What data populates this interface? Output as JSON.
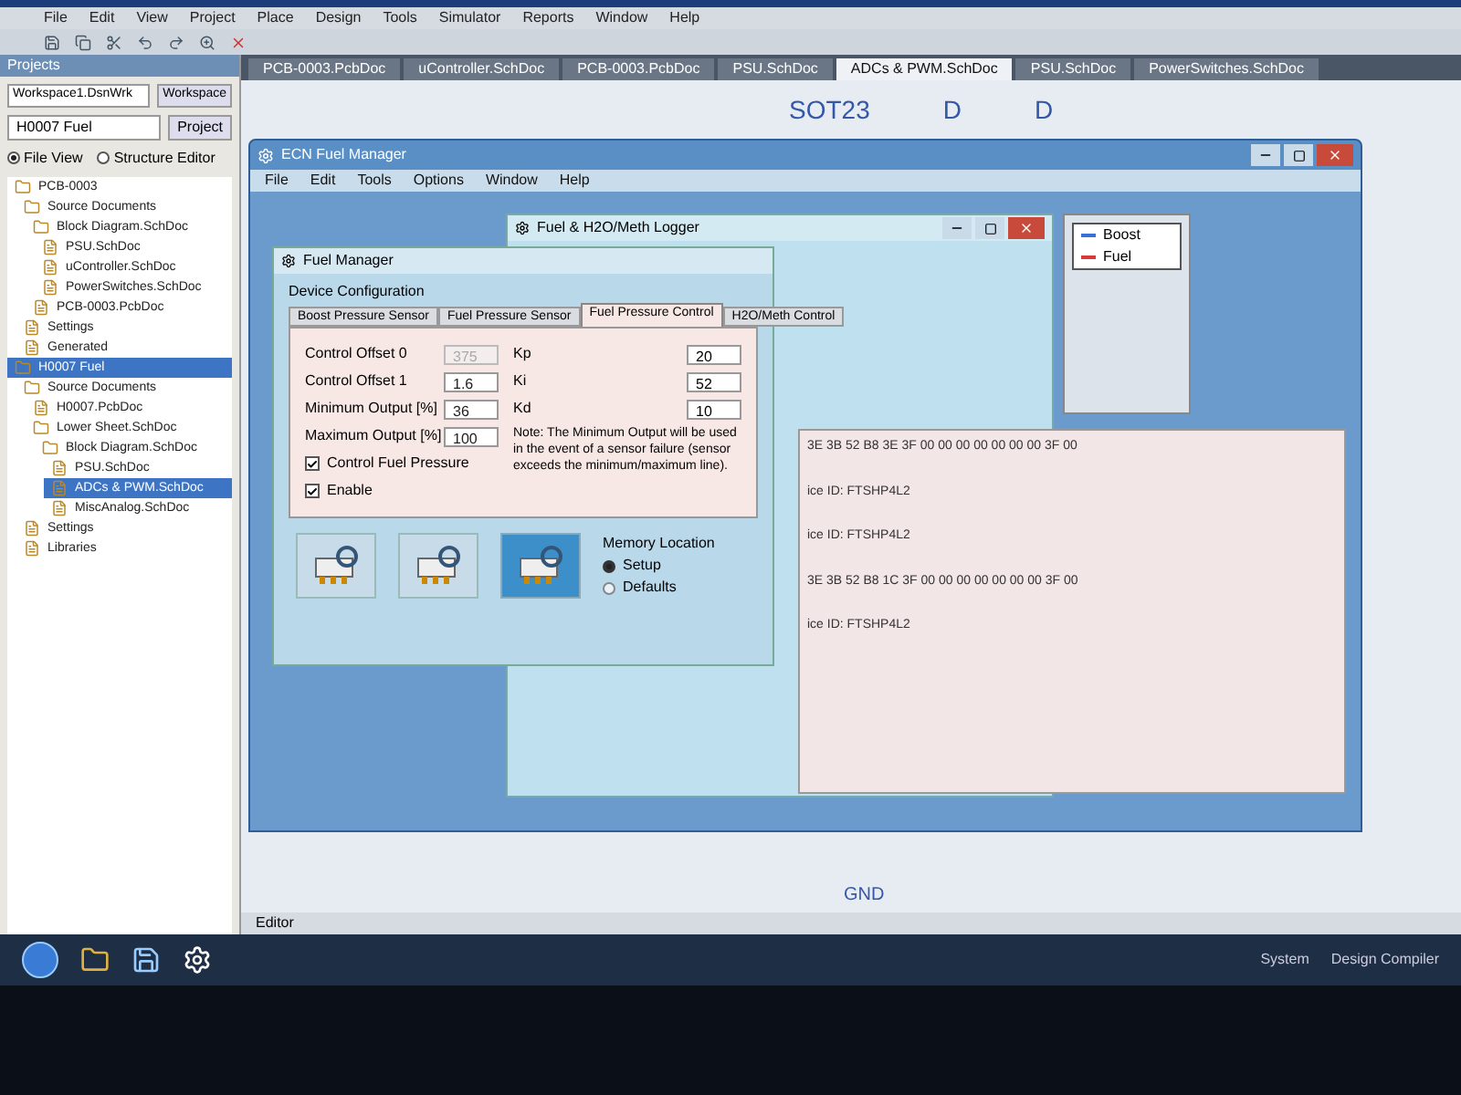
{
  "menu": [
    "File",
    "Edit",
    "View",
    "Project",
    "Place",
    "Design",
    "Tools",
    "Simulator",
    "Reports",
    "Window",
    "Help"
  ],
  "doc_tabs": [
    {
      "label": "PCB-0003.PcbDoc",
      "selected": false
    },
    {
      "label": "uController.SchDoc",
      "selected": false
    },
    {
      "label": "PCB-0003.PcbDoc",
      "selected": false
    },
    {
      "label": "PSU.SchDoc",
      "selected": false
    },
    {
      "label": "ADCs & PWM.SchDoc",
      "selected": true
    },
    {
      "label": "PSU.SchDoc",
      "selected": false
    },
    {
      "label": "PowerSwitches.SchDoc",
      "selected": false
    }
  ],
  "projects_panel": {
    "title": "Projects",
    "workspace": "Workspace1.DsnWrk",
    "workspace_button": "Workspace",
    "project": "H0007 Fuel",
    "project_button": "Project",
    "views": [
      {
        "label": "File View",
        "selected": true
      },
      {
        "label": "Structure Editor",
        "selected": false
      }
    ],
    "tree": [
      {
        "label": "PCB-0003",
        "selected": false,
        "children": [
          {
            "label": "Source Documents",
            "selected": false,
            "children": [
              {
                "label": "Block Diagram.SchDoc",
                "selected": false,
                "children": [
                  {
                    "label": "PSU.SchDoc",
                    "selected": false
                  },
                  {
                    "label": "uController.SchDoc",
                    "selected": false
                  },
                  {
                    "label": "PowerSwitches.SchDoc",
                    "selected": false
                  }
                ]
              },
              {
                "label": "PCB-0003.PcbDoc",
                "selected": false
              }
            ]
          },
          {
            "label": "Settings",
            "selected": false
          },
          {
            "label": "Generated",
            "selected": false
          }
        ]
      },
      {
        "label": "H0007 Fuel",
        "selected": true,
        "children": [
          {
            "label": "Source Documents",
            "selected": false,
            "children": [
              {
                "label": "H0007.PcbDoc",
                "selected": false
              },
              {
                "label": "Lower Sheet.SchDoc",
                "selected": false,
                "children": [
                  {
                    "label": "Block Diagram.SchDoc",
                    "selected": false,
                    "children": [
                      {
                        "label": "PSU.SchDoc",
                        "selected": false
                      },
                      {
                        "label": "ADCs & PWM.SchDoc",
                        "selected": true
                      },
                      {
                        "label": "MiscAnalog.SchDoc",
                        "selected": false
                      }
                    ]
                  }
                ]
              }
            ]
          },
          {
            "label": "Settings",
            "selected": false
          },
          {
            "label": "Libraries",
            "selected": false
          }
        ]
      }
    ]
  },
  "schematic": {
    "labels": [
      "SOT23",
      "D",
      "D",
      "GND"
    ]
  },
  "app_window": {
    "title": "ECN Fuel Manager",
    "menu": [
      "File",
      "Edit",
      "Tools",
      "Options",
      "Window",
      "Help"
    ]
  },
  "logger_window": {
    "title": "Fuel & H2O/Meth Logger",
    "legend": [
      {
        "label": "Boost",
        "color": "#3a6fd8"
      },
      {
        "label": "Fuel",
        "color": "#d83a3a"
      }
    ]
  },
  "log_lines": [
    "3E 3B 52 B8 3E 3F 00 00 00 00 00 00 00 3F 00",
    "ice ID: FTSHP4L2",
    "ice ID: FTSHP4L2",
    "3E 3B 52 B8 1C 3F 00 00 00 00 00 00 00 3F 00",
    "ice ID: FTSHP4L2"
  ],
  "dialog": {
    "title": "Fuel Manager",
    "group": "Device Configuration",
    "tabs": [
      {
        "label": "Boost Pressure Sensor",
        "selected": false
      },
      {
        "label": "Fuel Pressure Sensor",
        "selected": false
      },
      {
        "label": "Fuel Pressure Control",
        "selected": true
      },
      {
        "label": "H2O/Meth Control",
        "selected": false
      }
    ],
    "fields": [
      {
        "label": "Control Offset 0",
        "value": "375",
        "disabled": true
      },
      {
        "label": "Control Offset 1",
        "value": "1.6",
        "disabled": false
      },
      {
        "label": "Minimum Output [%]",
        "value": "36",
        "disabled": false
      },
      {
        "label": "Maximum Output [%]",
        "value": "100",
        "disabled": false
      }
    ],
    "gains": [
      {
        "label": "Kp",
        "value": "20"
      },
      {
        "label": "Ki",
        "value": "52"
      },
      {
        "label": "Kd",
        "value": "10"
      }
    ],
    "checks": [
      {
        "label": "Control Fuel Pressure",
        "checked": true
      },
      {
        "label": "Enable",
        "checked": true
      }
    ],
    "note": "Note: The Minimum Output will be used in the event of a sensor failure (sensor exceeds the minimum/maximum line).",
    "memory": {
      "title": "Memory Location",
      "options": [
        {
          "label": "Setup",
          "selected": true
        },
        {
          "label": "Defaults",
          "selected": false
        }
      ]
    }
  },
  "editor_label": "Editor",
  "status_bar": [
    "System",
    "Design Compiler"
  ]
}
